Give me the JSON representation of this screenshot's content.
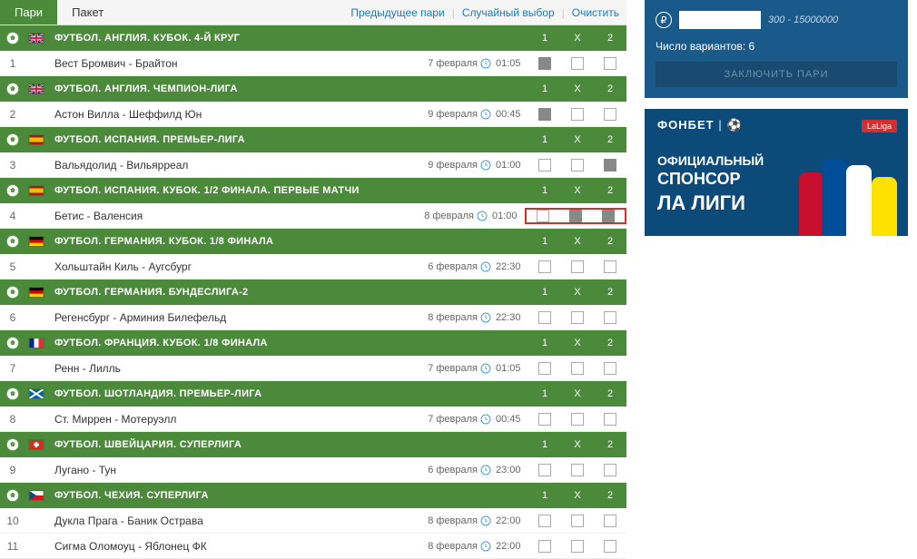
{
  "tabs": {
    "active": "Пари",
    "other": "Пакет"
  },
  "toplinks": {
    "prev": "Предыдущее пари",
    "random": "Случайный выбор",
    "clear": "Очистить"
  },
  "cols": {
    "c1": "1",
    "cx": "X",
    "c2": "2"
  },
  "leagues": [
    {
      "title": "ФУТБОЛ. АНГЛИЯ. КУБОК. 4-Й КРУГ",
      "flag": "gb",
      "matches": [
        {
          "num": "1",
          "name": "Вест Бромвич - Брайтон",
          "date": "7 февраля",
          "time": "01:05",
          "checked": [
            true,
            false,
            false
          ],
          "highlight": false
        }
      ]
    },
    {
      "title": "ФУТБОЛ. АНГЛИЯ. ЧЕМПИОН-ЛИГА",
      "flag": "gb",
      "matches": [
        {
          "num": "2",
          "name": "Астон Вилла - Шеффилд Юн",
          "date": "9 февраля",
          "time": "00:45",
          "checked": [
            true,
            false,
            false
          ],
          "highlight": false
        }
      ]
    },
    {
      "title": "ФУТБОЛ. ИСПАНИЯ. ПРЕМЬЕР-ЛИГА",
      "flag": "es",
      "matches": [
        {
          "num": "3",
          "name": "Вальядолид - Вильярреал",
          "date": "9 февраля",
          "time": "01:00",
          "checked": [
            false,
            false,
            true
          ],
          "highlight": false
        }
      ]
    },
    {
      "title": "ФУТБОЛ. ИСПАНИЯ. КУБОК. 1/2 ФИНАЛА. ПЕРВЫЕ МАТЧИ",
      "flag": "es",
      "matches": [
        {
          "num": "4",
          "name": "Бетис - Валенсия",
          "date": "8 февраля",
          "time": "01:00",
          "checked": [
            false,
            true,
            true
          ],
          "highlight": true
        }
      ]
    },
    {
      "title": "ФУТБОЛ. ГЕРМАНИЯ. КУБОК. 1/8 ФИНАЛА",
      "flag": "de",
      "matches": [
        {
          "num": "5",
          "name": "Хольштайн Киль - Аугсбург",
          "date": "6 февраля",
          "time": "22:30",
          "checked": [
            false,
            false,
            false
          ],
          "highlight": false
        }
      ]
    },
    {
      "title": "ФУТБОЛ. ГЕРМАНИЯ. БУНДЕСЛИГА-2",
      "flag": "de",
      "matches": [
        {
          "num": "6",
          "name": "Регенсбург - Арминия Билефельд",
          "date": "8 февраля",
          "time": "22:30",
          "checked": [
            false,
            false,
            false
          ],
          "highlight": false
        }
      ]
    },
    {
      "title": "ФУТБОЛ. ФРАНЦИЯ. КУБОК. 1/8 ФИНАЛА",
      "flag": "fr",
      "matches": [
        {
          "num": "7",
          "name": "Ренн - Лилль",
          "date": "7 февраля",
          "time": "01:05",
          "checked": [
            false,
            false,
            false
          ],
          "highlight": false
        }
      ]
    },
    {
      "title": "ФУТБОЛ. ШОТЛАНДИЯ. ПРЕМЬЕР-ЛИГА",
      "flag": "sc",
      "matches": [
        {
          "num": "8",
          "name": "Ст. Миррен - Мотеруэлл",
          "date": "7 февраля",
          "time": "00:45",
          "checked": [
            false,
            false,
            false
          ],
          "highlight": false
        }
      ]
    },
    {
      "title": "ФУТБОЛ. ШВЕЙЦАРИЯ. СУПЕРЛИГА",
      "flag": "ch",
      "matches": [
        {
          "num": "9",
          "name": "Лугано - Тун",
          "date": "6 февраля",
          "time": "23:00",
          "checked": [
            false,
            false,
            false
          ],
          "highlight": false
        }
      ]
    },
    {
      "title": "ФУТБОЛ. ЧЕХИЯ. СУПЕРЛИГА",
      "flag": "cz",
      "matches": [
        {
          "num": "10",
          "name": "Дукла Прага - Баник Острава",
          "date": "8 февраля",
          "time": "22:00",
          "checked": [
            false,
            false,
            false
          ],
          "highlight": false
        },
        {
          "num": "11",
          "name": "Сигма Оломоуц - Яблонец ФК",
          "date": "8 февраля",
          "time": "22:00",
          "checked": [
            false,
            false,
            false
          ],
          "highlight": false
        }
      ]
    }
  ],
  "widget": {
    "range": "300 - 15000000",
    "variants_label": "Число вариантов:",
    "variants_count": "6",
    "submit": "ЗАКЛЮЧИТЬ ПАРИ"
  },
  "banner": {
    "brand": "ФОНБЕТ",
    "laliga": "LaLiga",
    "line1": "ОФИЦИАЛЬНЫЙ",
    "line2": "СПОНСОР",
    "line3": "ЛА ЛИГИ"
  }
}
